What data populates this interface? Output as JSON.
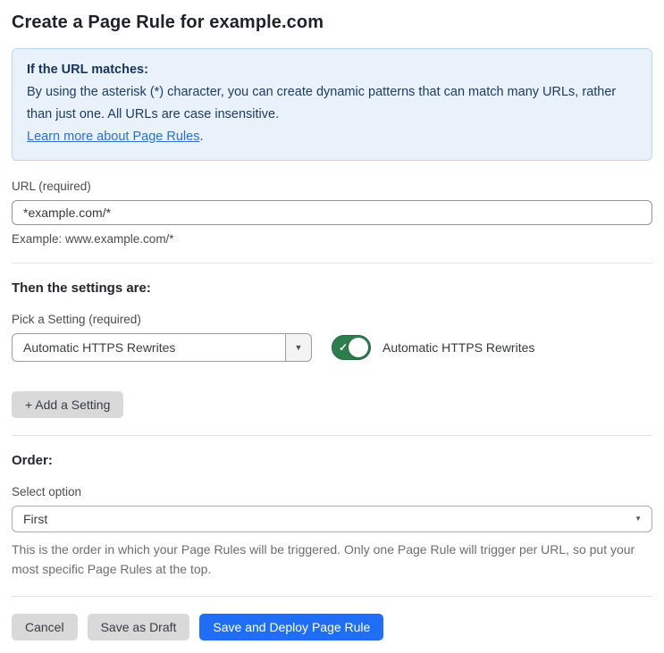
{
  "page": {
    "title": "Create a Page Rule for example.com"
  },
  "info_box": {
    "heading": "If the URL matches:",
    "body": "By using the asterisk (*) character, you can create dynamic patterns that can match many URLs, rather than just one. All URLs are case insensitive.",
    "link_label": "Learn more about Page Rules",
    "link_suffix": "."
  },
  "url_field": {
    "label": "URL (required)",
    "value": "*example.com/*",
    "example": "Example: www.example.com/*"
  },
  "settings": {
    "heading": "Then the settings are:",
    "pick_label": "Pick a Setting (required)",
    "selected_setting": "Automatic HTTPS Rewrites",
    "dropdown_caret_icon": "▼",
    "toggle_state": "on",
    "toggle_check_icon": "✓",
    "toggle_label": "Automatic HTTPS Rewrites",
    "add_button_label": "+ Add a Setting"
  },
  "order": {
    "heading": "Order:",
    "select_label": "Select option",
    "selected_option": "First",
    "select_caret_icon": "▼",
    "help_text": "This is the order in which your Page Rules will be triggered. Only one Page Rule will trigger per URL, so put your most specific Page Rules at the top."
  },
  "footer": {
    "cancel_label": "Cancel",
    "save_draft_label": "Save as Draft",
    "save_deploy_label": "Save and Deploy Page Rule"
  },
  "colors": {
    "accent_blue": "#1f6ef5",
    "toggle_green": "#2e7d4e",
    "info_bg": "#e9f2fb",
    "info_border": "#b9d7ee",
    "info_text": "#1d3b66",
    "link_blue": "#2f6fd3",
    "button_gray": "#d9d9d9"
  }
}
